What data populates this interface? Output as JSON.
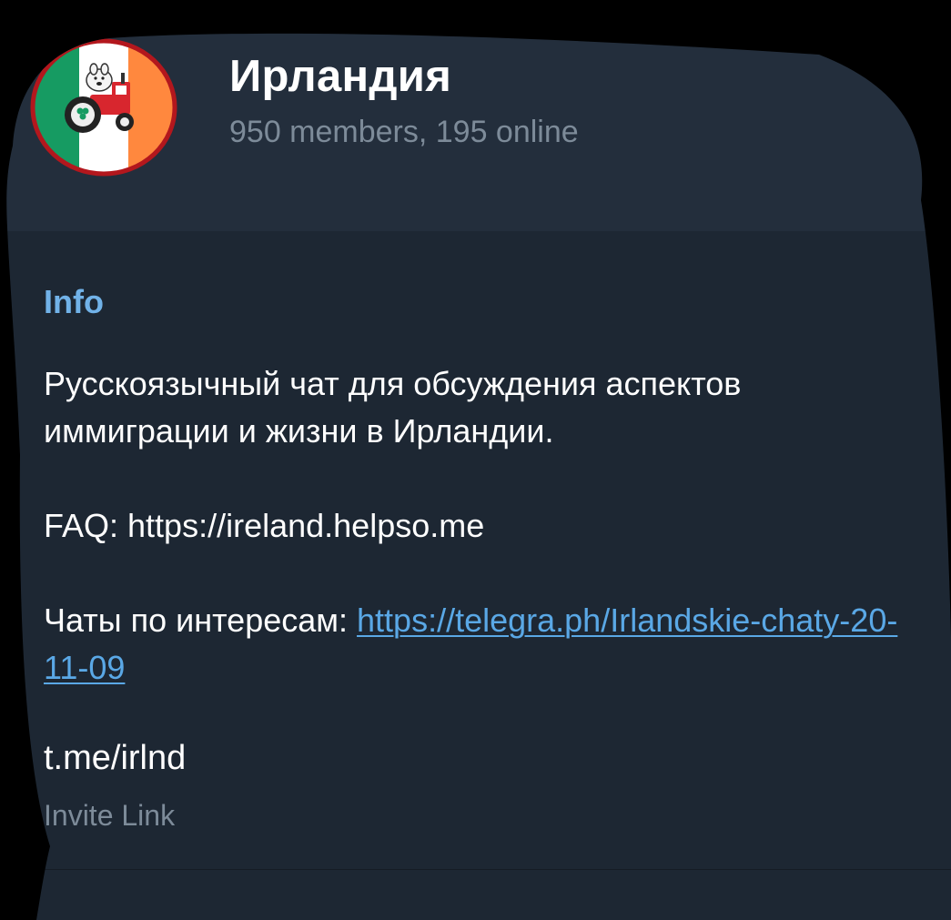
{
  "chat": {
    "title": "Ирландия",
    "subtitle": "950 members, 195 online",
    "avatar_icon": "ireland-flag-tractor-icon"
  },
  "info": {
    "section_label": "Info",
    "description_line": "Русскоязычный чат для обсуждения аспектов иммиграции и жизни в Ирландии.",
    "faq_prefix": "FAQ: ",
    "faq_url": "https://ireland.helpso.me",
    "chats_prefix": "Чаты по интересам: ",
    "chats_link": "https://telegra.ph/Irlandskie-chaty-20-11-09"
  },
  "invite": {
    "value": "t.me/irlnd",
    "label": "Invite Link"
  },
  "colors": {
    "header_bg": "#232e3c",
    "body_bg": "#1d2733",
    "accent": "#71b2e8",
    "link": "#5aa8e6",
    "secondary_text": "#7d8b99",
    "flag_green": "#169b62",
    "flag_orange": "#ff883e"
  }
}
